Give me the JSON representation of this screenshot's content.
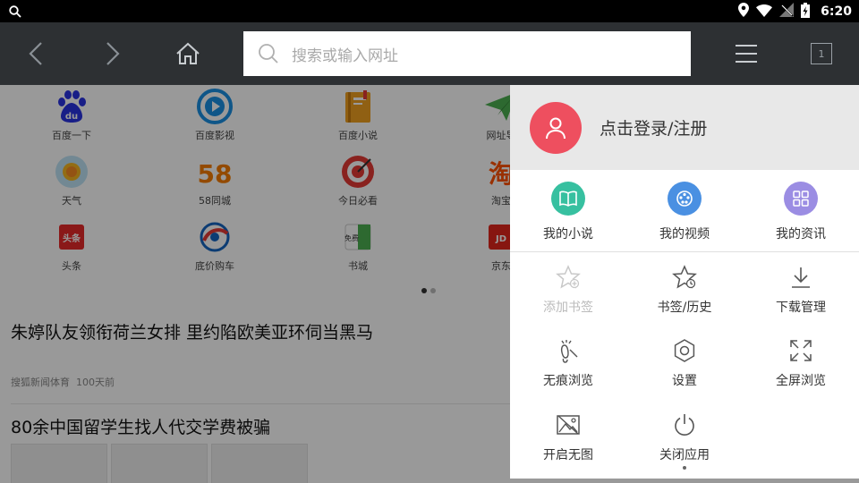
{
  "status_bar": {
    "time": "6:20",
    "icons": [
      "search-icon",
      "location-icon",
      "wifi-icon",
      "no-signal-icon",
      "battery-charging-icon"
    ]
  },
  "toolbar": {
    "search_placeholder": "搜索或输入网址",
    "tab_count": "1",
    "icons": [
      "back-icon",
      "forward-icon",
      "home-icon",
      "menu-icon"
    ]
  },
  "quick_grid": [
    {
      "label": "百度一下",
      "icon": "baidu-icon",
      "color": "#2932e1"
    },
    {
      "label": "百度影视",
      "icon": "video-play-icon",
      "color": "#1a8fe3"
    },
    {
      "label": "百度小说",
      "icon": "book-icon",
      "color": "#f0a020"
    },
    {
      "label": "网址导",
      "icon": "paper-plane-icon",
      "color": "#4caf50"
    },
    {
      "label": "天气",
      "icon": "weather-sun-icon",
      "color": "#f5b622"
    },
    {
      "label": "58同城",
      "icon": "58-logo-icon",
      "color": "#f57c00"
    },
    {
      "label": "今日必看",
      "icon": "target-icon",
      "color": "#e53935"
    },
    {
      "label": "淘宝",
      "icon": "taobao-icon",
      "color": "#ff5000"
    },
    {
      "label": "头条",
      "icon": "toutiao-icon",
      "color": "#e62828"
    },
    {
      "label": "底价购车",
      "icon": "car-deal-icon",
      "color": "#e53935"
    },
    {
      "label": "书城",
      "icon": "bookstore-icon",
      "color": "#4caf50"
    },
    {
      "label": "京东",
      "icon": "jd-icon",
      "color": "#e1251b"
    }
  ],
  "grid_logo_text": {
    "baidu": "du",
    "fiftyeight": "58",
    "taobao": "淘",
    "toutiao": "头条",
    "bookstore": "免费",
    "jd": "JD"
  },
  "news": [
    {
      "title": "朱婷队友领衔荷兰女排 里约陷欧美亚环伺当黑马",
      "source": "搜狐新闻体育",
      "time": "100天前"
    },
    {
      "title": "80余中国留学生找人代交学费被骗"
    }
  ],
  "menu": {
    "login_label": "点击登录/注册",
    "features": [
      {
        "label": "我的小说",
        "icon": "book-open-icon",
        "color": "#37c0a0"
      },
      {
        "label": "我的视频",
        "icon": "film-reel-icon",
        "color": "#4a90e2"
      },
      {
        "label": "我的资讯",
        "icon": "grid-apps-icon",
        "color": "#9b8de3"
      }
    ],
    "tools": [
      {
        "label": "添加书签",
        "icon": "star-add-icon",
        "enabled": false
      },
      {
        "label": "书签/历史",
        "icon": "star-clock-icon",
        "enabled": true
      },
      {
        "label": "下载管理",
        "icon": "download-icon",
        "enabled": true
      },
      {
        "label": "无痕浏览",
        "icon": "footprint-icon",
        "enabled": true
      },
      {
        "label": "设置",
        "icon": "settings-gear-icon",
        "enabled": true
      },
      {
        "label": "全屏浏览",
        "icon": "fullscreen-icon",
        "enabled": true
      },
      {
        "label": "开启无图",
        "icon": "no-image-icon",
        "enabled": true
      },
      {
        "label": "关闭应用",
        "icon": "power-icon",
        "enabled": true
      }
    ]
  }
}
